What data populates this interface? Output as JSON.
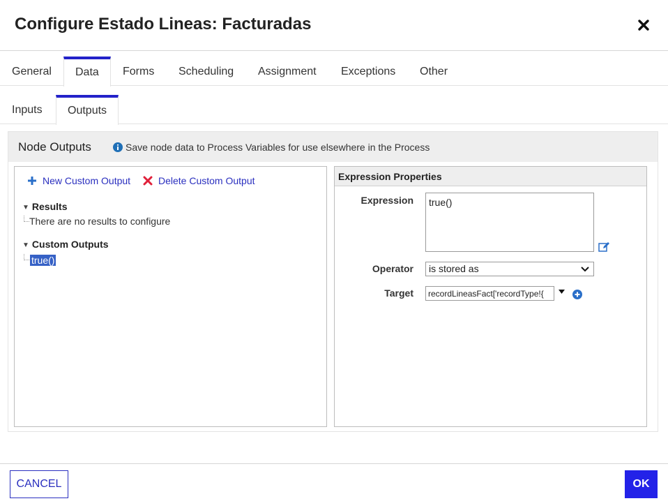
{
  "dialog": {
    "title": "Configure Estado Lineas: Facturadas",
    "close_icon": "close-icon"
  },
  "tabs": [
    {
      "label": "General",
      "active": false
    },
    {
      "label": "Data",
      "active": true
    },
    {
      "label": "Forms",
      "active": false
    },
    {
      "label": "Scheduling",
      "active": false
    },
    {
      "label": "Assignment",
      "active": false
    },
    {
      "label": "Exceptions",
      "active": false
    },
    {
      "label": "Other",
      "active": false
    }
  ],
  "subtabs": [
    {
      "label": "Inputs",
      "active": false
    },
    {
      "label": "Outputs",
      "active": true
    }
  ],
  "banner": {
    "title": "Node Outputs",
    "info_text": "Save node data to Process Variables for use elsewhere in the Process"
  },
  "left_panel": {
    "new_output_label": "New Custom Output",
    "delete_output_label": "Delete Custom Output",
    "results_heading": "Results",
    "results_empty_text": "There are no results to configure",
    "custom_outputs_heading": "Custom Outputs",
    "custom_outputs_items": [
      "true()"
    ]
  },
  "right_panel": {
    "header": "Expression Properties",
    "expression_label": "Expression",
    "expression_value": "true()",
    "operator_label": "Operator",
    "operator_value": "is stored as",
    "target_label": "Target",
    "target_value": "recordLineasFact['recordType!{"
  },
  "footer": {
    "cancel_label": "CANCEL",
    "ok_label": "OK"
  },
  "colors": {
    "accent": "#2322c9",
    "link": "#2a2fbf",
    "ok_button": "#2322e8",
    "selection": "#3661c6",
    "delete_icon": "#e0203a",
    "info_icon": "#1f6fb6"
  }
}
